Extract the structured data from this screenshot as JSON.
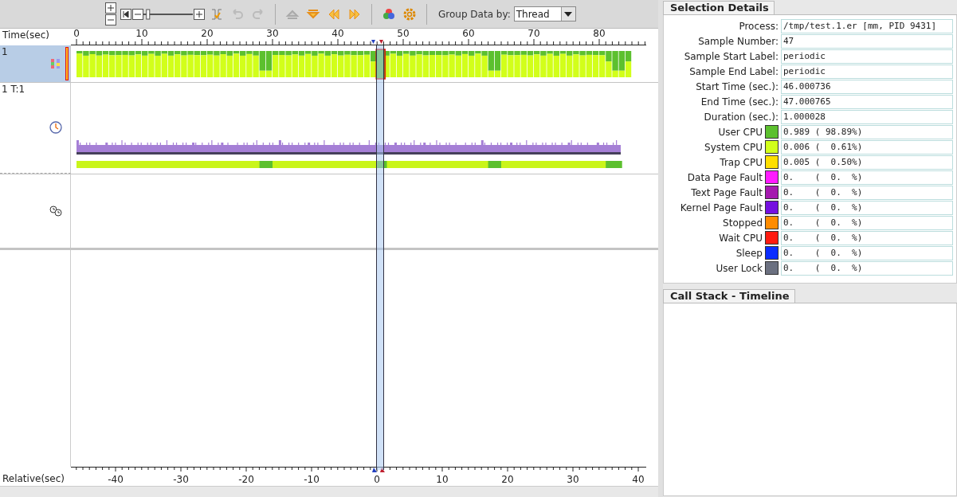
{
  "toolbar": {
    "zoom_slider": {
      "level": 0.05
    },
    "group_label": "Group Data by:",
    "group_value": "Thread"
  },
  "timeline": {
    "time_label": "Time(sec)",
    "time_ticks": [
      "0",
      "10",
      "20",
      "30",
      "40",
      "50",
      "60",
      "70",
      "80"
    ],
    "relative_label": "Relative(sec)",
    "relative_ticks": [
      "-40",
      "-30",
      "-20",
      "-10",
      "0",
      "10",
      "20",
      "30",
      "40"
    ],
    "rows": [
      {
        "label": "1",
        "kind": "samples",
        "selected": true
      },
      {
        "label": "1 T:1",
        "kind": "clock",
        "selected": false
      },
      {
        "kind": "sync",
        "selected": false
      }
    ]
  },
  "selection_details": {
    "tab": "Selection Details",
    "fields": [
      {
        "label": "Process:",
        "value": "/tmp/test.1.er [mm, PID 9431]"
      },
      {
        "label": "Sample Number:",
        "value": "47"
      },
      {
        "label": "Sample Start Label:",
        "value": "periodic"
      },
      {
        "label": "Sample End Label:",
        "value": "periodic"
      },
      {
        "label": "Start Time (sec.):",
        "value": "46.000736"
      },
      {
        "label": "End Time (sec.):",
        "value": "47.000765"
      },
      {
        "label": "Duration (sec.):",
        "value": "1.000028"
      }
    ],
    "metrics": [
      {
        "label": "User CPU",
        "color": "#5cc02e",
        "value": "0.989 ( 98.89%)"
      },
      {
        "label": "System CPU",
        "color": "#d2ff1a",
        "value": "0.006 (  0.61%)"
      },
      {
        "label": "Trap CPU",
        "color": "#ffdf00",
        "value": "0.005 (  0.50%)"
      },
      {
        "label": "Data Page Fault",
        "color": "#ff1aff",
        "value": "0.    (  0.  %)"
      },
      {
        "label": "Text Page Fault",
        "color": "#a51aaf",
        "value": "0.    (  0.  %)"
      },
      {
        "label": "Kernel Page Fault",
        "color": "#7510e0",
        "value": "0.    (  0.  %)"
      },
      {
        "label": "Stopped",
        "color": "#ff8c00",
        "value": "0.    (  0.  %)"
      },
      {
        "label": "Wait CPU",
        "color": "#ff1a10",
        "value": "0.    (  0.  %)"
      },
      {
        "label": "Sleep",
        "color": "#0a2cff",
        "value": "0.    (  0.  %)"
      },
      {
        "label": "User Lock",
        "color": "#6b7080",
        "value": "0.    (  0.  %)"
      }
    ]
  },
  "call_stack": {
    "tab": "Call Stack - Timeline"
  }
}
